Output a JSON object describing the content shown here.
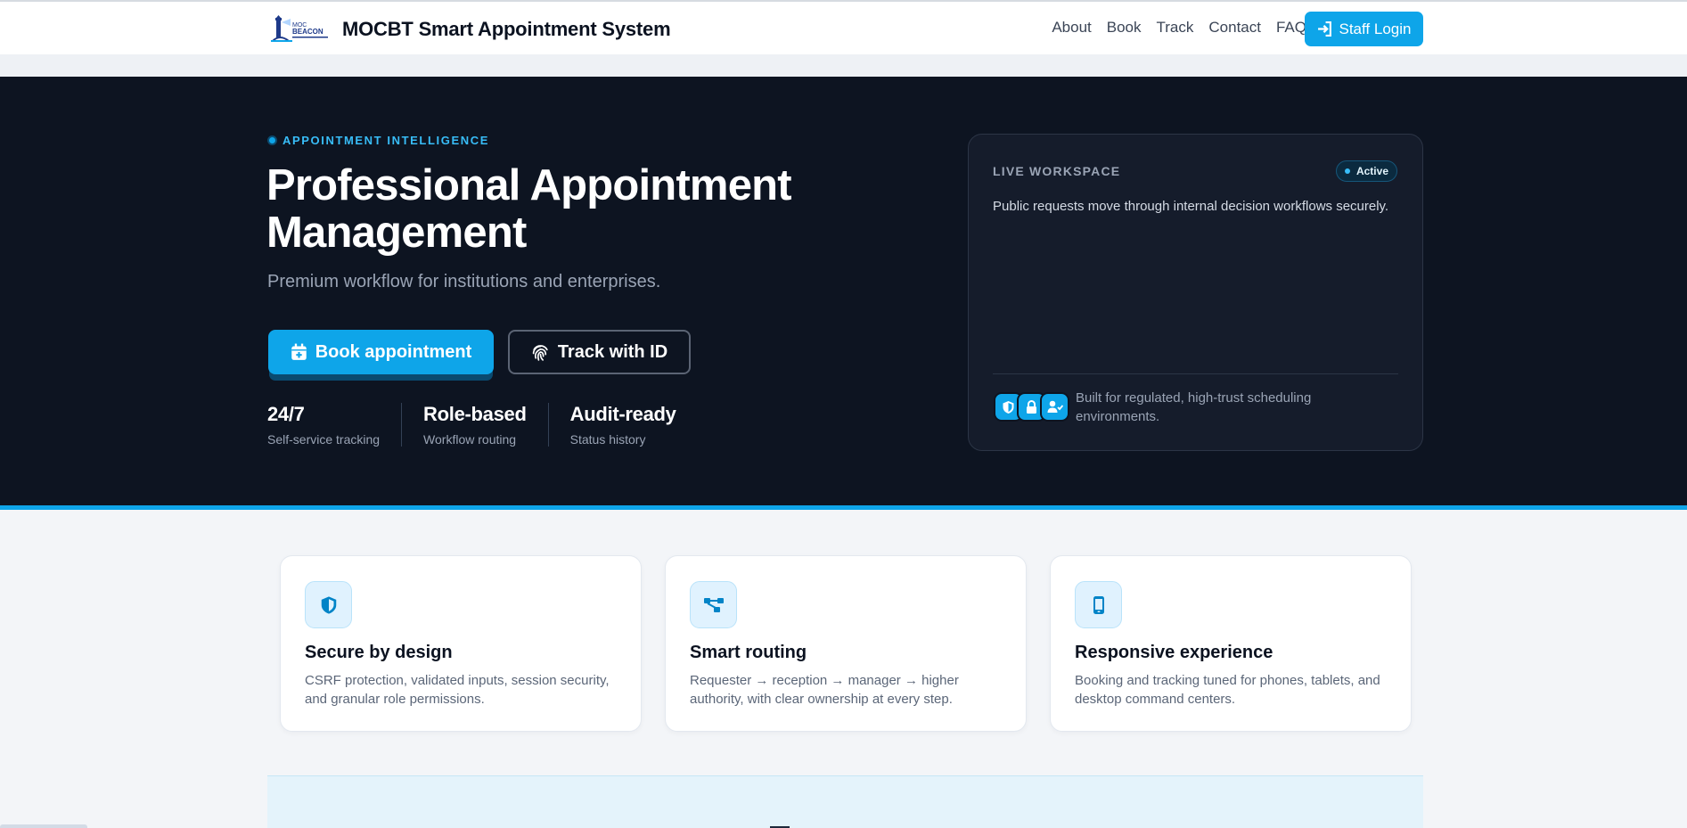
{
  "nav": {
    "brand_title": "MOCBT Smart Appointment System",
    "logo_text": "MOC BEACON",
    "links": [
      "About",
      "Book",
      "Track",
      "Contact",
      "FAQ"
    ],
    "staff_login": "Staff Login"
  },
  "hero": {
    "eyebrow": "APPOINTMENT INTELLIGENCE",
    "title": "Professional Appointment Management",
    "subtitle": "Premium workflow for institutions and enterprises.",
    "book_button": "Book appointment",
    "track_button": "Track with ID",
    "stats": [
      {
        "value": "24/7",
        "label": "Self-service tracking"
      },
      {
        "value": "Role-based",
        "label": "Workflow routing"
      },
      {
        "value": "Audit-ready",
        "label": "Status history"
      }
    ]
  },
  "workspace": {
    "label": "LIVE WORKSPACE",
    "badge": "Active",
    "description": "Public requests move through internal decision workflows securely.",
    "footer": "Built for regulated, high-trust scheduling environments.",
    "icons": [
      "shield-icon",
      "lock-icon",
      "user-check-icon"
    ]
  },
  "features": [
    {
      "icon": "shield-icon",
      "title": "Secure by design",
      "desc": "CSRF protection, validated inputs, session security, and granular role permissions."
    },
    {
      "icon": "routing-icon",
      "title": "Smart routing",
      "desc": "Requester → reception → manager → higher authority, with clear ownership at every step."
    },
    {
      "icon": "mobile-icon",
      "title": "Responsive experience",
      "desc": "Booking and tracking tuned for phones, tablets, and desktop command centers."
    }
  ],
  "colors": {
    "accent": "#0ea5e9",
    "hero_bg": "#0d1421",
    "card_bg": "#151c2b"
  }
}
